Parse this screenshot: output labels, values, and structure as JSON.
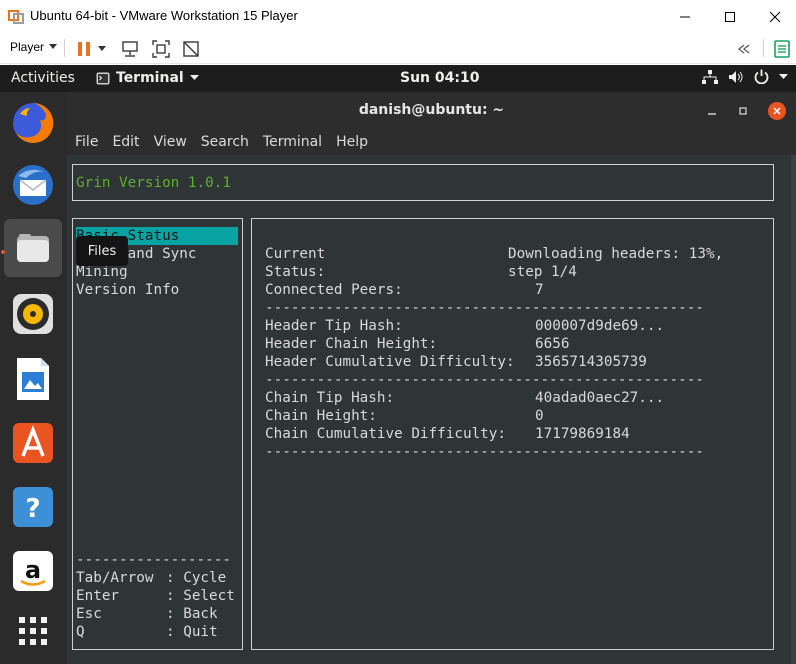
{
  "vmware": {
    "title": "Ubuntu 64-bit - VMware Workstation 15 Player",
    "player_menu": "Player",
    "colors": {
      "pause_icon": "#e8741e",
      "toolbar_icon": "#3a3a3a",
      "library_icon": "#1aa260"
    }
  },
  "gnome": {
    "activities": "Activities",
    "app_menu": "Terminal",
    "clock": "Sun 04:10"
  },
  "dock": {
    "tooltip": "Files",
    "items": [
      "firefox-icon",
      "thunderbird-icon",
      "files-icon",
      "rhythmbox-icon",
      "libreoffice-writer-icon",
      "ubuntu-software-icon",
      "help-icon",
      "amazon-icon",
      "show-apps-icon"
    ]
  },
  "terminal": {
    "title": "danish@ubuntu: ~",
    "menu": [
      "File",
      "Edit",
      "View",
      "Search",
      "Terminal",
      "Help"
    ]
  },
  "tui": {
    "version": "Grin Version 1.0.1",
    "menu_items": [
      "Basic Status",
      "Peers and Sync",
      "Mining",
      "Version Info"
    ],
    "selected_item": "Basic Status",
    "menu_separator": "------------------",
    "keys": [
      {
        "key": "Tab/Arrow",
        "action": "Cycle"
      },
      {
        "key": "Enter",
        "action": "Select"
      },
      {
        "key": "Esc",
        "action": "Back"
      },
      {
        "key": "Q",
        "action": "Quit"
      }
    ],
    "status": {
      "current_label": "Current",
      "status_label": "Status:",
      "status_value_1": "Downloading headers: 13%,",
      "status_value_2": "step 1/4",
      "connected_peers_label": "Connected Peers:",
      "connected_peers": "7",
      "separator": "---------------------------------------------------",
      "header_tip_hash_label": "Header Tip Hash:",
      "header_tip_hash": "000007d9de69...",
      "header_chain_height_label": "Header Chain Height:",
      "header_chain_height": "6656",
      "header_cumulative_difficulty_label": "Header Cumulative Difficulty:",
      "header_cumulative_difficulty": "3565714305739",
      "chain_tip_hash_label": "Chain Tip Hash:",
      "chain_tip_hash": "40adad0aec27...",
      "chain_height_label": "Chain Height:",
      "chain_height": "0",
      "chain_cumulative_difficulty_label": "Chain Cumulative Difficulty:",
      "chain_cumulative_difficulty": "17179869184"
    },
    "colors": {
      "version_text": "#5faf2f",
      "selection": "#0aa3a3",
      "text": "#d9d9d9",
      "background": "#2f3436"
    }
  }
}
